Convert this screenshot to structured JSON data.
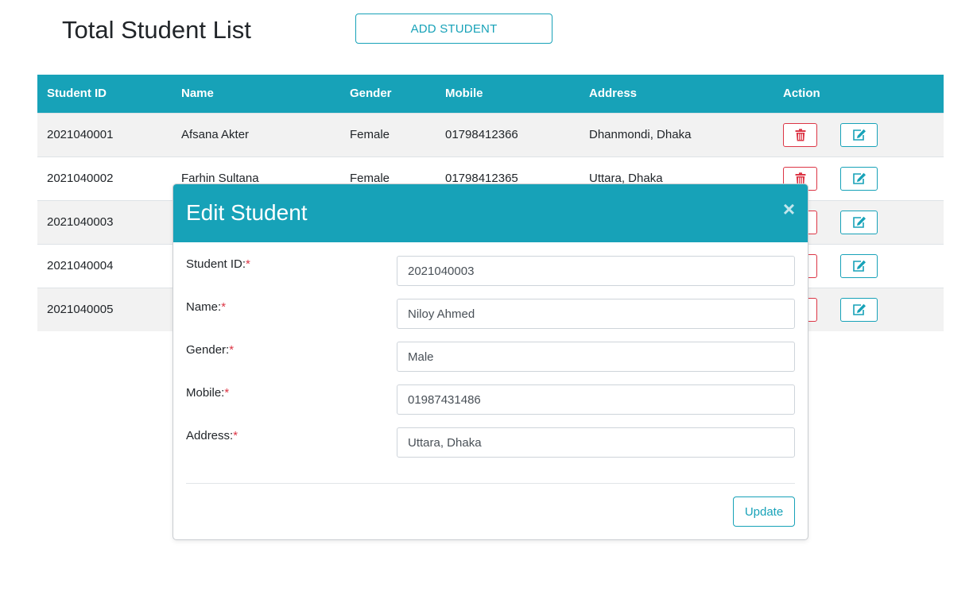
{
  "header": {
    "title": "Total Student List",
    "add_button": "ADD STUDENT"
  },
  "table": {
    "columns": [
      "Student ID",
      "Name",
      "Gender",
      "Mobile",
      "Address",
      "Action"
    ],
    "rows": [
      {
        "id": "2021040001",
        "name": "Afsana Akter",
        "gender": "Female",
        "mobile": "01798412366",
        "address": "Dhanmondi, Dhaka"
      },
      {
        "id": "2021040002",
        "name": "Farhin Sultana",
        "gender": "Female",
        "mobile": "01798412365",
        "address": "Uttara, Dhaka"
      },
      {
        "id": "2021040003",
        "name": "",
        "gender": "",
        "mobile": "",
        "address": ""
      },
      {
        "id": "2021040004",
        "name": "",
        "gender": "",
        "mobile": "",
        "address": ""
      },
      {
        "id": "2021040005",
        "name": "",
        "gender": "",
        "mobile": "",
        "address": ""
      }
    ],
    "delete_icon": "trash-icon",
    "edit_icon": "edit-icon"
  },
  "modal": {
    "title": "Edit Student",
    "close": "×",
    "fields": [
      {
        "label": "Student ID:",
        "required_mark": "*",
        "value": "2021040003"
      },
      {
        "label": "Name:",
        "required_mark": "*",
        "value": "Niloy Ahmed"
      },
      {
        "label": "Gender:",
        "required_mark": "*",
        "value": "Male"
      },
      {
        "label": "Mobile:",
        "required_mark": "*",
        "value": "01987431486"
      },
      {
        "label": "Address:",
        "required_mark": "*",
        "value": "Uttara, Dhaka"
      }
    ],
    "update_button": "Update"
  },
  "colors": {
    "accent": "#17a2b8",
    "danger": "#dc3545"
  }
}
